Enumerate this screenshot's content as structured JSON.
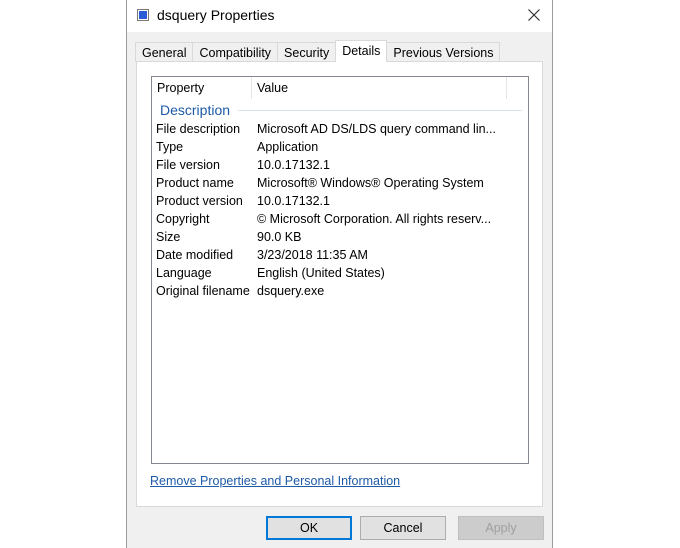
{
  "window": {
    "title": "dsquery Properties"
  },
  "tabs": [
    {
      "label": "General"
    },
    {
      "label": "Compatibility"
    },
    {
      "label": "Security"
    },
    {
      "label": "Details"
    },
    {
      "label": "Previous Versions"
    }
  ],
  "active_tab": "Details",
  "list": {
    "columns": [
      "Property",
      "Value"
    ],
    "group": "Description",
    "rows": [
      {
        "property": "File description",
        "value": "Microsoft AD DS/LDS query command lin..."
      },
      {
        "property": "Type",
        "value": "Application"
      },
      {
        "property": "File version",
        "value": "10.0.17132.1"
      },
      {
        "property": "Product name",
        "value": "Microsoft® Windows® Operating System"
      },
      {
        "property": "Product version",
        "value": "10.0.17132.1"
      },
      {
        "property": "Copyright",
        "value": "© Microsoft Corporation. All rights reserv..."
      },
      {
        "property": "Size",
        "value": "90.0 KB"
      },
      {
        "property": "Date modified",
        "value": "3/23/2018 11:35 AM"
      },
      {
        "property": "Language",
        "value": "English (United States)"
      },
      {
        "property": "Original filename",
        "value": "dsquery.exe"
      }
    ]
  },
  "link": {
    "remove_label": "Remove Properties and Personal Information"
  },
  "buttons": {
    "ok": "OK",
    "cancel": "Cancel",
    "apply": "Apply"
  },
  "colors": {
    "accent": "#0078d7",
    "link": "#1e5aa8",
    "group_header": "#1e5aa8"
  }
}
